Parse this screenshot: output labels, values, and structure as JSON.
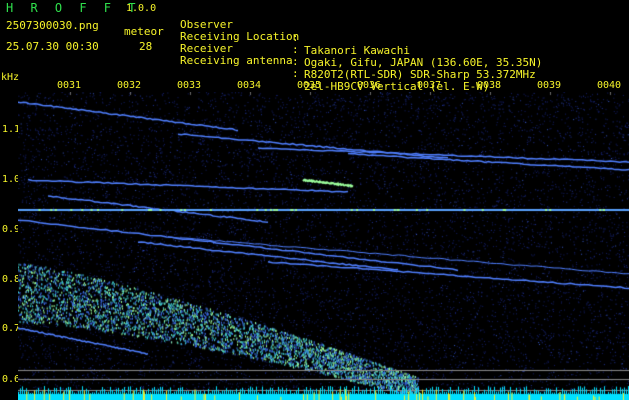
{
  "header": {
    "app_name": "H R O F F T",
    "app_version": "1.0.0",
    "filename": "2507300030.png",
    "datetime": "25.07.30 00:30",
    "meteor_label": "meteor",
    "meteor_count": "28"
  },
  "info": [
    {
      "key": "Observer",
      "value": "Takanori Kawachi"
    },
    {
      "key": "Receiving Location",
      "value": "Ogaki, Gifu, JAPAN (136.60E, 35.35N)"
    },
    {
      "key": "Receiver",
      "value": "R820T2(RTL-SDR) SDR-Sharp 53.372MHz"
    },
    {
      "key": "Receiving antenna",
      "value": "2el-HB9CV Vertical (el. E-W)"
    }
  ],
  "info_separator": ":",
  "spectrogram": {
    "unit": "kHz",
    "y_ticks": [
      "1.1",
      "1.0",
      "0.9",
      "0.8",
      "0.7",
      "0.6"
    ],
    "x_ticks": [
      "0031",
      "0032",
      "0033",
      "0034",
      "0035",
      "0036",
      "0037",
      "0038",
      "0039",
      "0040"
    ],
    "colors": {
      "background": "#000000",
      "noise": "#1a2c8c",
      "trace": "#4f7fff",
      "strong": "#9cff9c",
      "baseline": "#00e0ff",
      "label_green": "#2fe04c",
      "label_yellow": "#f6f42a"
    }
  }
}
